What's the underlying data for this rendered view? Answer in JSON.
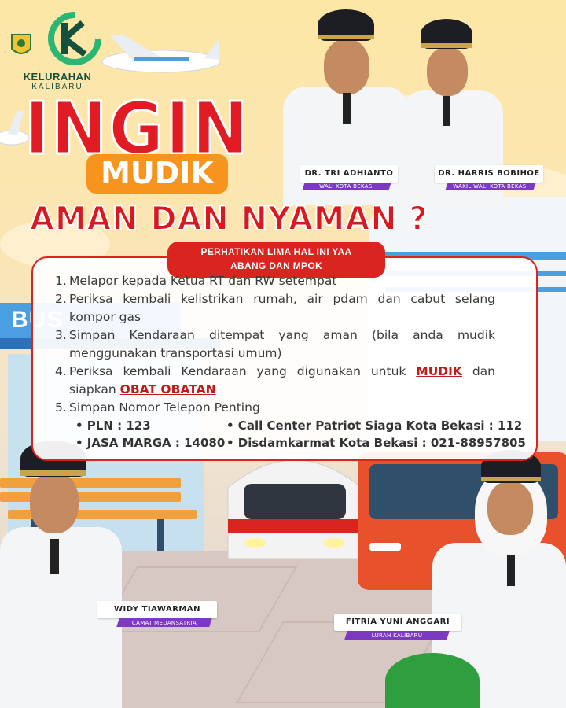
{
  "logo": {
    "title": "KELURAHAN",
    "subtitle": "KALIBARU",
    "colors": {
      "primary": "#2bb673",
      "dark": "#15503d"
    }
  },
  "headline": {
    "line1": "INGIN",
    "line2": "MUDIK",
    "line3": "AMAN DAN NYAMAN ?",
    "colors": {
      "red": "#e01b24",
      "orange": "#f7941d"
    }
  },
  "officials": [
    {
      "name": "DR. TRI ADHIANTO",
      "role": "WALI KOTA BEKASI"
    },
    {
      "name": "DR. HARRIS BOBIHOE",
      "role": "WAKIL WALI KOTA BEKASI"
    },
    {
      "name": "WIDY TIAWARMAN",
      "role": "CAMAT MEDANSATRIA"
    },
    {
      "name": "FITRIA YUNI ANGGARI",
      "role": "LURAH KALIBARU"
    }
  ],
  "card": {
    "tab_line1": "PERHATIKAN LIMA HAL INI YAA",
    "tab_line2": "ABANG DAN MPOK",
    "items": [
      {
        "num": "1.",
        "text": "Melapor kepada Ketua RT dan RW setempat"
      },
      {
        "num": "2.",
        "text": "Periksa kembali kelistrikan rumah, air pdam dan cabut selang kompor gas"
      },
      {
        "num": "3.",
        "text": "Simpan Kendaraan ditempat yang aman (bila anda mudik menggunakan transportasi umum)"
      },
      {
        "num": "4.",
        "text_a": "Periksa kembali Kendaraan yang digunakan untuk ",
        "em_a": "MUDIK",
        "text_b": " dan siapkan ",
        "em_b": "OBAT OBATAN"
      },
      {
        "num": "5.",
        "text": "Simpan Nomor Telepon Penting"
      }
    ],
    "contacts": [
      "• PLN : 123",
      "• JASA MARGA : 14080",
      "• Call Center Patriot Siaga Kota Bekasi : 112",
      "• Disdamkarmat Kota Bekasi : 021-88957805"
    ]
  },
  "scenery": {
    "bus_stop_sign": "BUS"
  },
  "icons": [
    "kelurahan-logo-icon",
    "city-seal-icon",
    "airplane-icon",
    "cruise-ship-icon",
    "train-icon",
    "bus-icon",
    "bench-icon"
  ]
}
